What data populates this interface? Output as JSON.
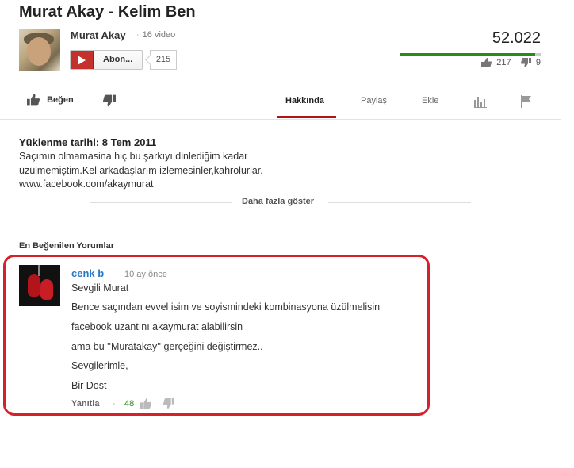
{
  "video": {
    "title": "Murat Akay - Kelim Ben",
    "views": "52.022",
    "likes": "217",
    "dislikes": "9",
    "like_ratio": 0.96
  },
  "channel": {
    "name": "Murat Akay",
    "video_count": "16 video",
    "subscribe_label": "Abon...",
    "subscriber_count": "215"
  },
  "actions": {
    "like_label": "Beğen",
    "tabs": [
      "Hakkında",
      "Paylaş",
      "Ekle"
    ],
    "active_tab": "Hakkında",
    "icons": [
      "like-icon",
      "dislike-icon",
      "stats-icon",
      "flag-icon"
    ]
  },
  "about": {
    "uploaded": "Yüklenme tarihi: 8 Tem 2011",
    "description_lines": [
      "Saçımın olmamasina hiç bu şarkıyı dinlediğim kadar",
      "üzülmemiştim.Kel arkadaşlarım izlemesinler,kahrolurlar.",
      "www.facebook.com/akaymurat"
    ],
    "show_more": "Daha fazla göster"
  },
  "comments": {
    "section_title": "En Beğenilen Yorumlar",
    "top": {
      "author": "cenk b",
      "time": "10 ay önce",
      "lines": [
        "Sevgili Murat",
        "Bence saçından evvel isim ve soyismindeki kombinasyona üzülmelisin",
        "facebook uzantını akaymurat alabilirsin",
        "ama bu ''Muratakay'' gerçeğini değiştirmez..",
        "Sevgilerimle,",
        "Bir Dost"
      ],
      "reply_label": "Yanıtla",
      "separator": "·",
      "likes": "48"
    }
  },
  "colors": {
    "accent_red": "#b31217",
    "highlight_red": "#d6202a",
    "link_blue": "#2a79c4",
    "like_green": "#2b8a17"
  }
}
